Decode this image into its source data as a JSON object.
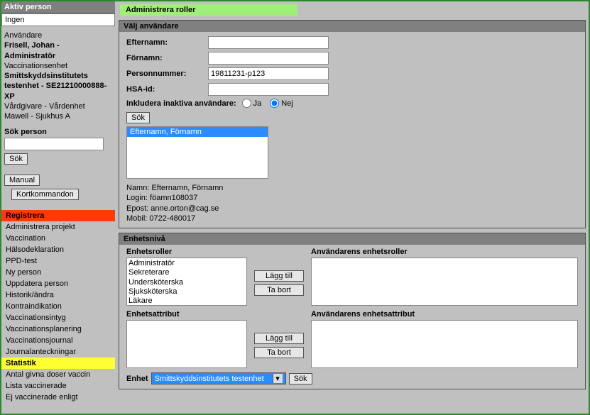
{
  "sidebar": {
    "active_label": "Aktiv person",
    "active_value": "Ingen",
    "user_label": "Användare",
    "user_name": "Frisell, Johan - Administratör",
    "unit_label": "Vaccinationsenhet",
    "unit_name": "Smittskyddsinstitutets testenhet - SE21210000888-XP",
    "provider_label": "Vårdgivare - Vårdenhet",
    "provider_value": "Mawell - Sjukhus A",
    "search_label": "Sök person",
    "search_value": "",
    "search_btn": "Sök",
    "manual_btn": "Manual",
    "kort_btn": "Kortkommandon",
    "menu": {
      "registrera": "Registrera",
      "items1": [
        "Administrera projekt",
        "Vaccination",
        "Hälsodeklaration",
        "PPD-test",
        "Ny person",
        "Uppdatera person",
        "Historik/ändra",
        "Kontraindikation",
        "Vaccinationsintyg",
        "Vaccinationsplanering",
        "Vaccinationsjournal",
        "Journalanteckningar"
      ],
      "statistik": "Statistik",
      "items2": [
        "Antal givna doser vaccin",
        "Lista vaccinerade",
        "Ej vaccinerade enligt"
      ]
    }
  },
  "page_title": "Administrera roller",
  "user_panel": {
    "title": "Välj användare",
    "labels": {
      "lastname": "Efternamn:",
      "firstname": "Förnamn:",
      "personnummer": "Personnummer:",
      "hsa": "HSA-id:",
      "inactive": "Inkludera inaktiva användare:",
      "ja": "Ja",
      "nej": "Nej"
    },
    "values": {
      "lastname": "",
      "firstname": "",
      "personnummer": "19811231-p123",
      "hsa": ""
    },
    "inactive_selected": "nej",
    "search_btn": "Sök",
    "list_selected": "Efternamn, Förnamn",
    "info": {
      "name_label": "Namn:",
      "name_value": "Efternamn, Förnamn",
      "login_label": "Login:",
      "login_value": "föamn108037",
      "email_label": "Epost:",
      "email_value": "anne.orton@cag.se",
      "mobile_label": "Mobil:",
      "mobile_value": "0722-480017"
    }
  },
  "level_panel": {
    "title": "Enhetsnivå",
    "roles_label": "Enhetsroller",
    "user_roles_label": "Användarens enhetsroller",
    "attrs_label": "Enhetsattribut",
    "user_attrs_label": "Användarens enhetsattribut",
    "roles": [
      "Administratör",
      "Sekreterare",
      "Undersköterska",
      "Sjuksköterska",
      "Läkare"
    ],
    "add_btn": "Lägg till",
    "remove_btn": "Ta bort",
    "enhet_label": "Enhet",
    "enhet_selected": "Smittskyddsinstitutets testenhet",
    "search_btn": "Sök"
  }
}
